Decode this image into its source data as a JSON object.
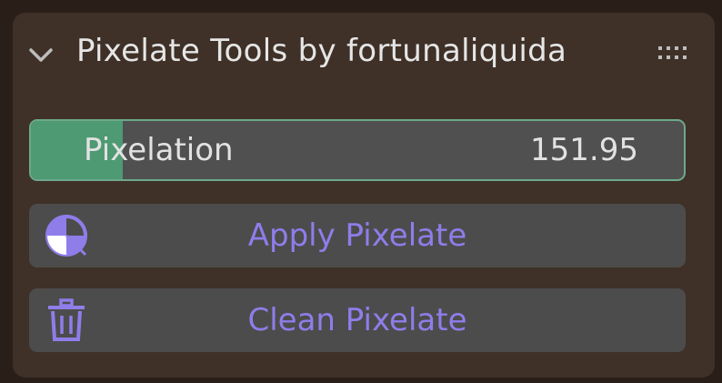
{
  "panel": {
    "title": "Pixelate Tools by fortunaliquida",
    "collapse_icon": "chevron-down-icon",
    "drag_icon": "drag-handle-icon"
  },
  "pixelation": {
    "label": "Pixelation",
    "value": "151.95",
    "fill_fraction": 0.14
  },
  "buttons": {
    "apply": {
      "label": "Apply Pixelate",
      "icon": "pie-chart-icon"
    },
    "clean": {
      "label": "Clean Pixelate",
      "icon": "trash-icon"
    }
  },
  "colors": {
    "panel_bg": "#3f3128",
    "slider_fill": "#4d9a73",
    "slider_border": "#6ea88a",
    "button_bg": "#4c4c4c",
    "button_text": "#8f7dea"
  }
}
